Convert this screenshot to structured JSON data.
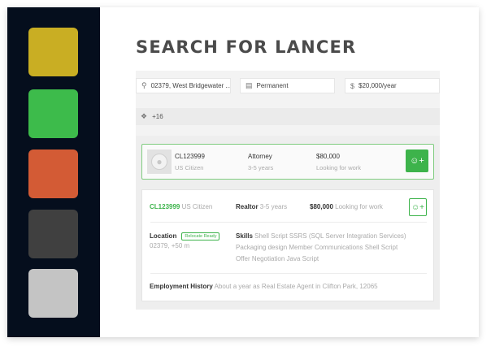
{
  "sidebar": {
    "swatches": [
      {
        "name": "yellow-swatch",
        "color": "#c9ae23"
      },
      {
        "name": "green-swatch",
        "color": "#3dbb4b"
      },
      {
        "name": "orange-swatch",
        "color": "#d35b35"
      },
      {
        "name": "dark-grey-swatch",
        "color": "#404040"
      },
      {
        "name": "light-grey-swatch",
        "color": "#c4c4c4"
      }
    ]
  },
  "header": {
    "title": "SEARCH FOR LANCER"
  },
  "filters": {
    "location": "02379, West Bridgewater ...",
    "type": "Permanent",
    "salary": "$20,000/year",
    "tags": "+16"
  },
  "result1": {
    "id": "CL123999",
    "citizenship": "US Citizen",
    "role": "Attorney",
    "experience": "3-5 years",
    "salary": "$80,000",
    "status": "Looking for work"
  },
  "result2": {
    "id": "CL123999",
    "citizenship": "US Citizen",
    "role": "Realtor",
    "experience": "3-5 years",
    "salary": "$80,000",
    "status": "Looking for work",
    "location_label": "Location",
    "relocate_badge": "Relocate Ready",
    "location_value": "02379, +50 m",
    "skills_label": "Skills",
    "skills_line1": "Shell Script SSRS (SQL Server Integration Services)",
    "skills_line2": "Packaging design Member Communications Shell Script",
    "skills_line3": "Offer Negotiation Java Script",
    "history_label": "Employment History",
    "history_value": "About a year as Real Estate Agent in Clifton Park, 12065"
  },
  "colors": {
    "accent": "#3db34b",
    "sidebar_bg": "#050e1d"
  }
}
